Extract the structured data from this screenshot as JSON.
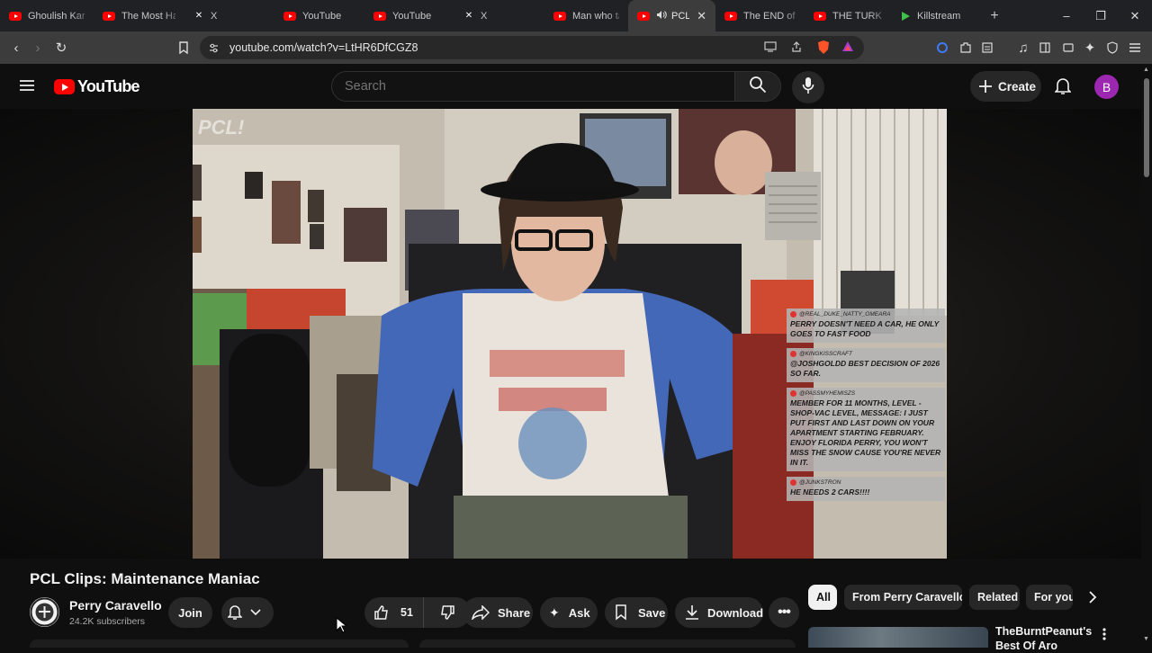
{
  "browser": {
    "tabs": [
      {
        "label": "Ghoulish Karı",
        "icon": "youtube-icon",
        "width": 104
      },
      {
        "label": "The Most Hat",
        "icon": "youtube-icon",
        "width": 101
      },
      {
        "label": "X",
        "icon": "x-icon",
        "width": 100
      },
      {
        "label": "YouTube",
        "icon": "youtube-icon",
        "width": 100
      },
      {
        "label": "YouTube",
        "icon": "youtube-icon",
        "width": 100
      },
      {
        "label": "X",
        "icon": "x-icon",
        "width": 100
      },
      {
        "label": "Man who tau",
        "icon": "youtube-icon",
        "width": 93
      },
      {
        "label": "PCL C",
        "icon": "youtube-icon",
        "width": 97,
        "active": true,
        "audio": true
      },
      {
        "label": "The END of L",
        "icon": "youtube-icon",
        "width": 99
      },
      {
        "label": "THE TURKEY",
        "icon": "youtube-icon",
        "width": 96
      },
      {
        "label": "Killstream",
        "icon": "play-icon",
        "width": 100
      }
    ],
    "url": "youtube.com/watch?v=LtHR6DfCGZ8"
  },
  "youtube": {
    "logo_text": "YouTube",
    "search_placeholder": "Search",
    "create_label": "Create",
    "avatar_letter": "B"
  },
  "video": {
    "watermark": "PCL!",
    "chat": [
      {
        "user": "@REAL_DUKE_NATTY_OMEARA",
        "text": "Perry doesn't need a car, he only goes to fast food"
      },
      {
        "user": "@KINGKISSCRAFT",
        "text": "@JoshGoldd Best decision of 2026 so far."
      },
      {
        "user": "@PASSMYHEMISZS",
        "text": "Member for 11 months, Level - Shop-Vac level, Message: I just put first and last down on your apartment starting February. Enjoy Florida Perry, you won't miss the snow cause you're never in it."
      },
      {
        "user": "@JUNKSTRON",
        "text": "He needs 2 cars!!!!"
      }
    ]
  },
  "details": {
    "title": "PCL Clips: Maintenance Maniac",
    "channel": "Perry Caravello",
    "subscribers": "24.2K subscribers",
    "join_label": "Join",
    "likes": "51",
    "share_label": "Share",
    "ask_label": "Ask",
    "save_label": "Save",
    "download_label": "Download"
  },
  "sidebar": {
    "chips": [
      "All",
      "From Perry Caravello",
      "Related",
      "For you"
    ],
    "related_title": "TheBurntPeanut's Best Of Aro"
  },
  "colors": {
    "yt_red": "#ff0000",
    "background": "#0f0f0f",
    "pill": "#272727",
    "avatar": "#9c27b0"
  }
}
